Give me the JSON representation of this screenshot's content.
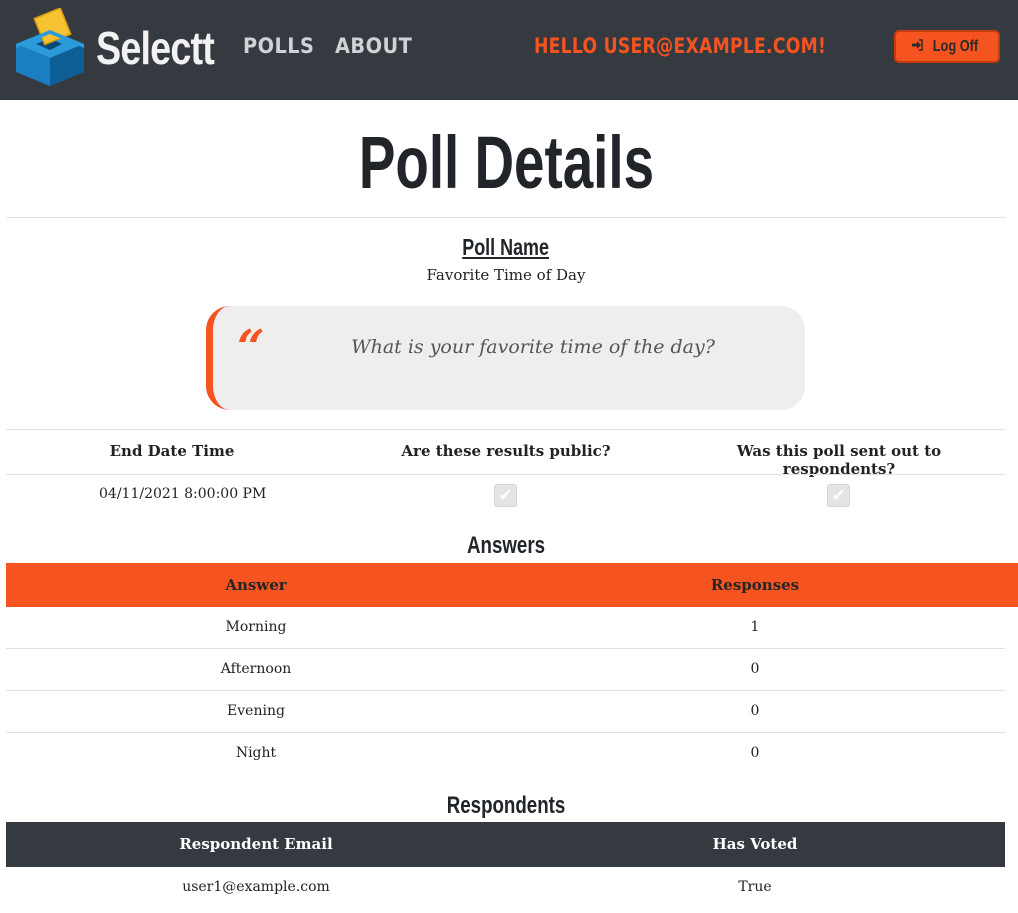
{
  "nav": {
    "brand": "Selectt",
    "links": [
      "POLLS",
      "ABOUT"
    ],
    "greeting": "HELLO USER@EXAMPLE.COM!",
    "logoff_label": "Log Off",
    "logoff_icon": "sign-in-icon"
  },
  "page": {
    "title": "Poll Details"
  },
  "poll": {
    "name_label": "Poll Name",
    "name": "Favorite Time of Day",
    "quote_mark": "“",
    "question": "What is your favorite time of the day?"
  },
  "details": {
    "headers": [
      "End Date Time",
      "Are these results public?",
      "Was this poll sent out to respondents?"
    ],
    "end_date_time": "04/11/2021 8:00:00 PM",
    "results_public": true,
    "sent_to_respondents": true,
    "check_glyph": "✔"
  },
  "answers": {
    "title": "Answers",
    "headers": [
      "Answer",
      "Responses"
    ],
    "rows": [
      {
        "answer": "Morning",
        "responses": "1"
      },
      {
        "answer": "Afternoon",
        "responses": "0"
      },
      {
        "answer": "Evening",
        "responses": "0"
      },
      {
        "answer": "Night",
        "responses": "0"
      }
    ]
  },
  "respondents": {
    "title": "Respondents",
    "headers": [
      "Respondent Email",
      "Has Voted"
    ],
    "rows": [
      {
        "email": "user1@example.com",
        "has_voted": "True"
      }
    ]
  },
  "colors": {
    "accent": "#f5531f",
    "navbar": "#343a40",
    "quote_bg": "#eeeeee",
    "logo_blue": "#1a7fc0",
    "logo_yellow": "#f6c232"
  }
}
